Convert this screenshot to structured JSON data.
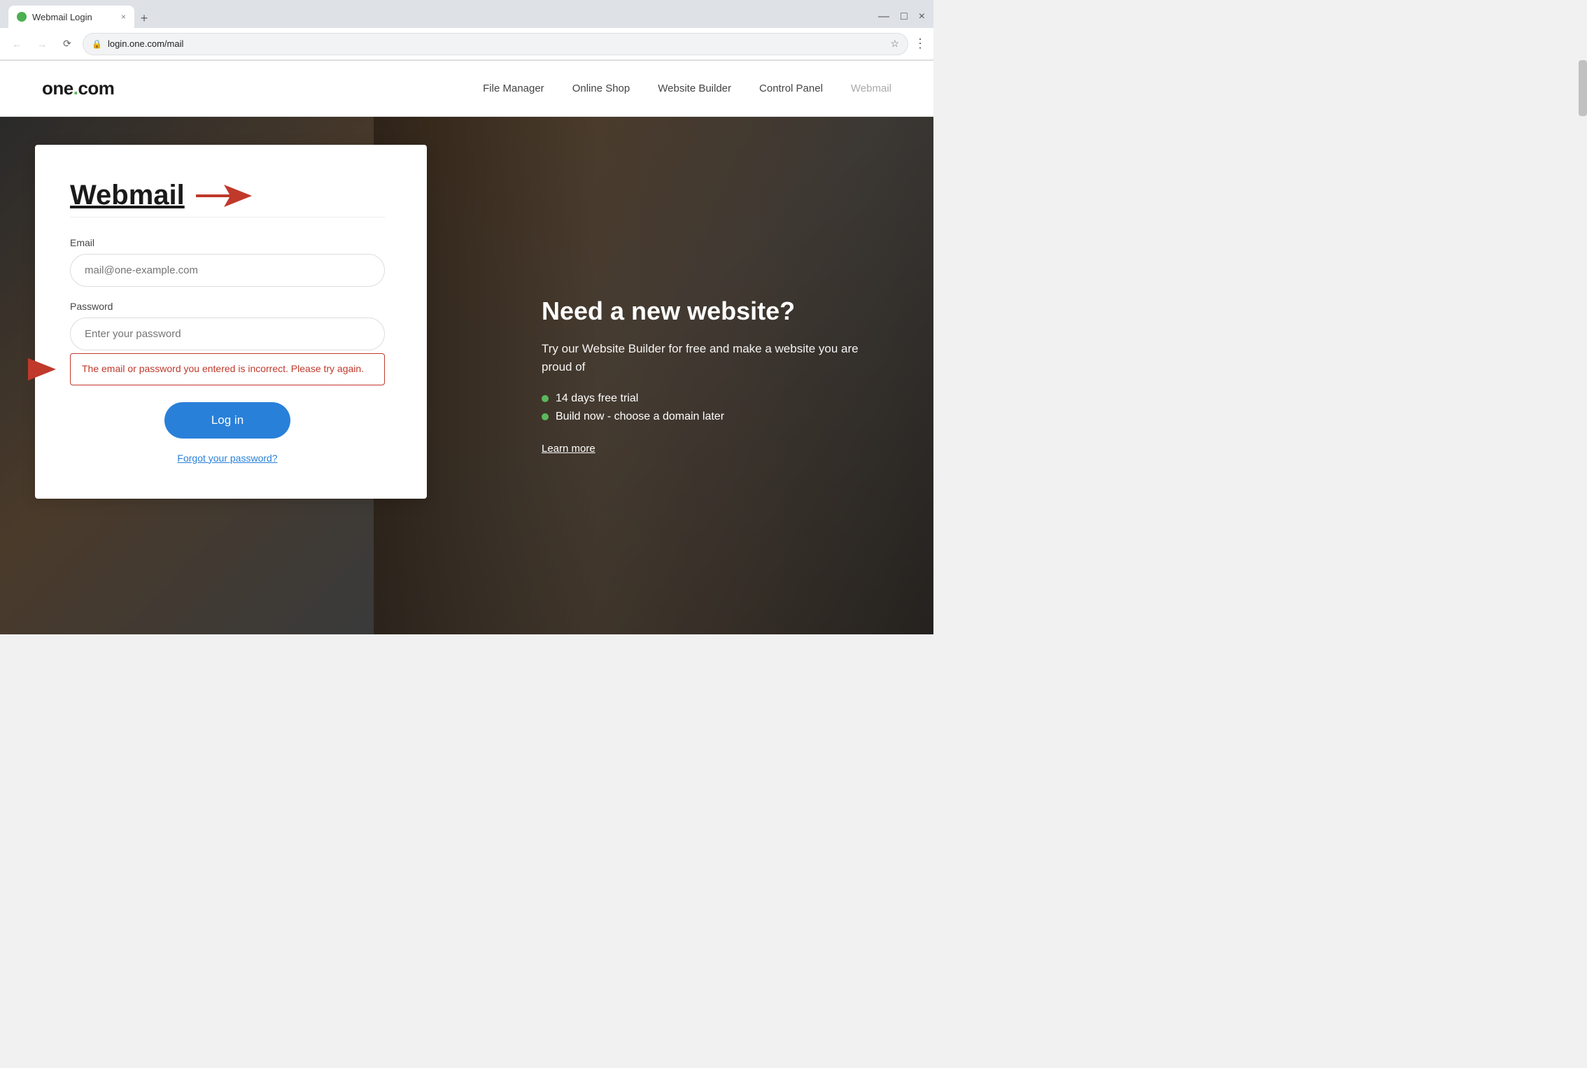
{
  "browser": {
    "tab_title": "Webmail Login",
    "tab_close": "×",
    "tab_new": "+",
    "address": "login.one.com/mail",
    "window_minimize": "—",
    "window_maximize": "□",
    "window_close": "×"
  },
  "header": {
    "logo_text_one": "one",
    "logo_dot": ".",
    "logo_text_com": "com",
    "nav": {
      "file_manager": "File Manager",
      "online_shop": "Online Shop",
      "website_builder": "Website Builder",
      "control_panel": "Control Panel",
      "webmail": "Webmail"
    }
  },
  "login_card": {
    "title": "Webmail",
    "email_label": "Email",
    "email_placeholder": "mail@one-example.com",
    "password_label": "Password",
    "password_placeholder": "Enter your password",
    "error_message": "The email or password you entered is incorrect. Please try again.",
    "login_button": "Log in",
    "forgot_password": "Forgot your password?"
  },
  "hero": {
    "title": "Need a new website?",
    "subtitle": "Try our Website Builder for free and make a website you are proud of",
    "bullets": [
      "14 days free trial",
      "Build now - choose a domain later"
    ],
    "learn_more": "Learn more"
  }
}
